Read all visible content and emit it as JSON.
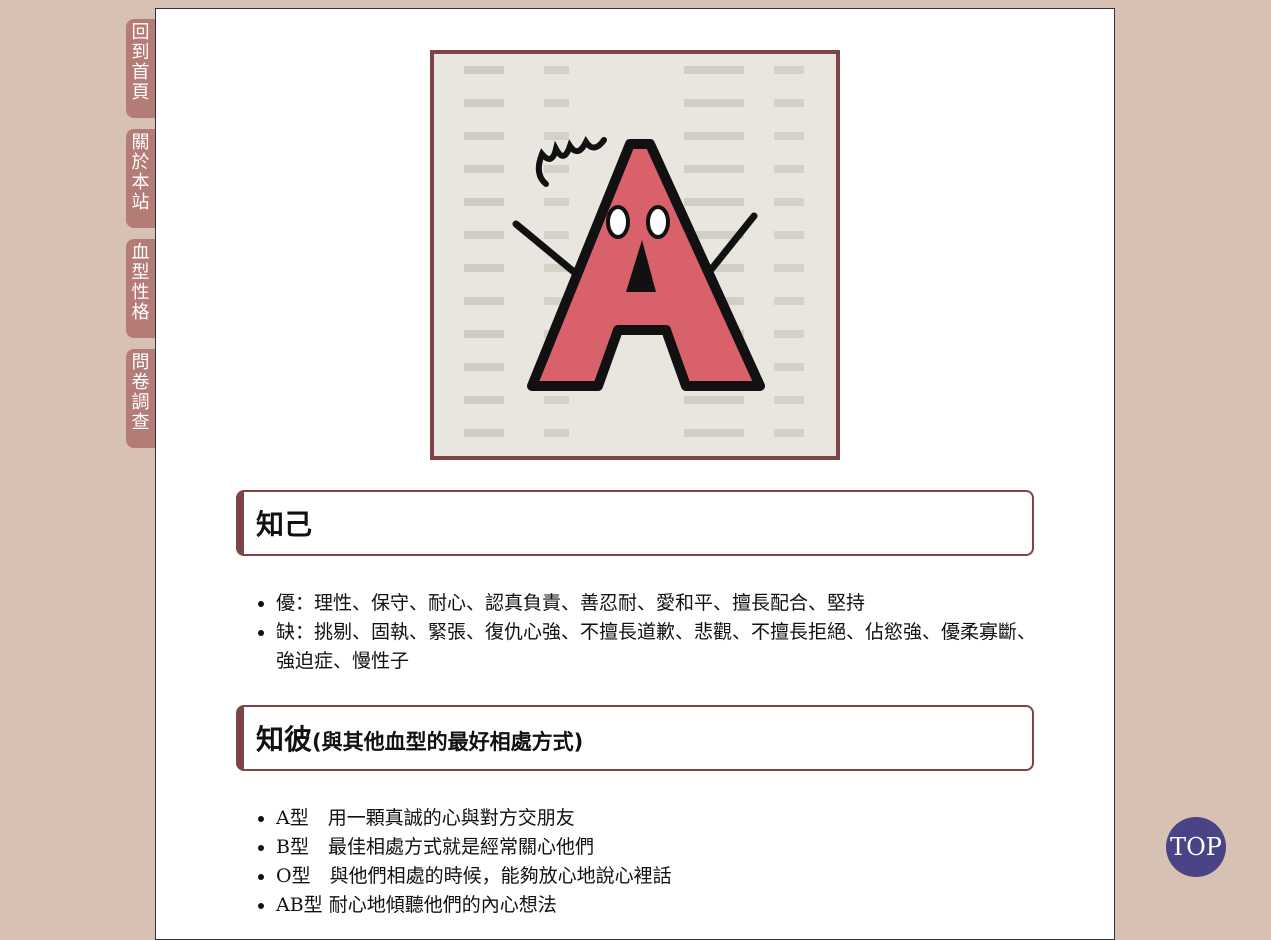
{
  "side_nav": {
    "items": [
      {
        "label": "回到首頁"
      },
      {
        "label": "關於本站"
      },
      {
        "label": "血型性格"
      },
      {
        "label": "問卷調查"
      }
    ]
  },
  "hero": {
    "letter": "A"
  },
  "section1": {
    "title": "知己",
    "items": [
      "優：理性、保守、耐心、認真負責、善忍耐、愛和平、擅長配合、堅持",
      "缺：挑剔、固執、緊張、復仇心強、不擅長道歉、悲觀、不擅長拒絕、佔慾強、優柔寡斷、強迫症、慢性子"
    ]
  },
  "section2": {
    "title": "知彼",
    "subtitle": "(與其他血型的最好相處方式)",
    "items": [
      "A型　用一顆真誠的心與對方交朋友",
      "B型　最佳相處方式就是經常關心他們",
      "O型　與他們相處的時候，能夠放心地說心裡話",
      "AB型 耐心地傾聽他們的內心想法"
    ]
  },
  "top_button": {
    "label": "TOP"
  },
  "colors": {
    "background": "#d6c1b3",
    "side_tab": "#b57b76",
    "accent": "#7e4546",
    "top_button": "#4a4486",
    "letter_fill": "#d9616b"
  }
}
